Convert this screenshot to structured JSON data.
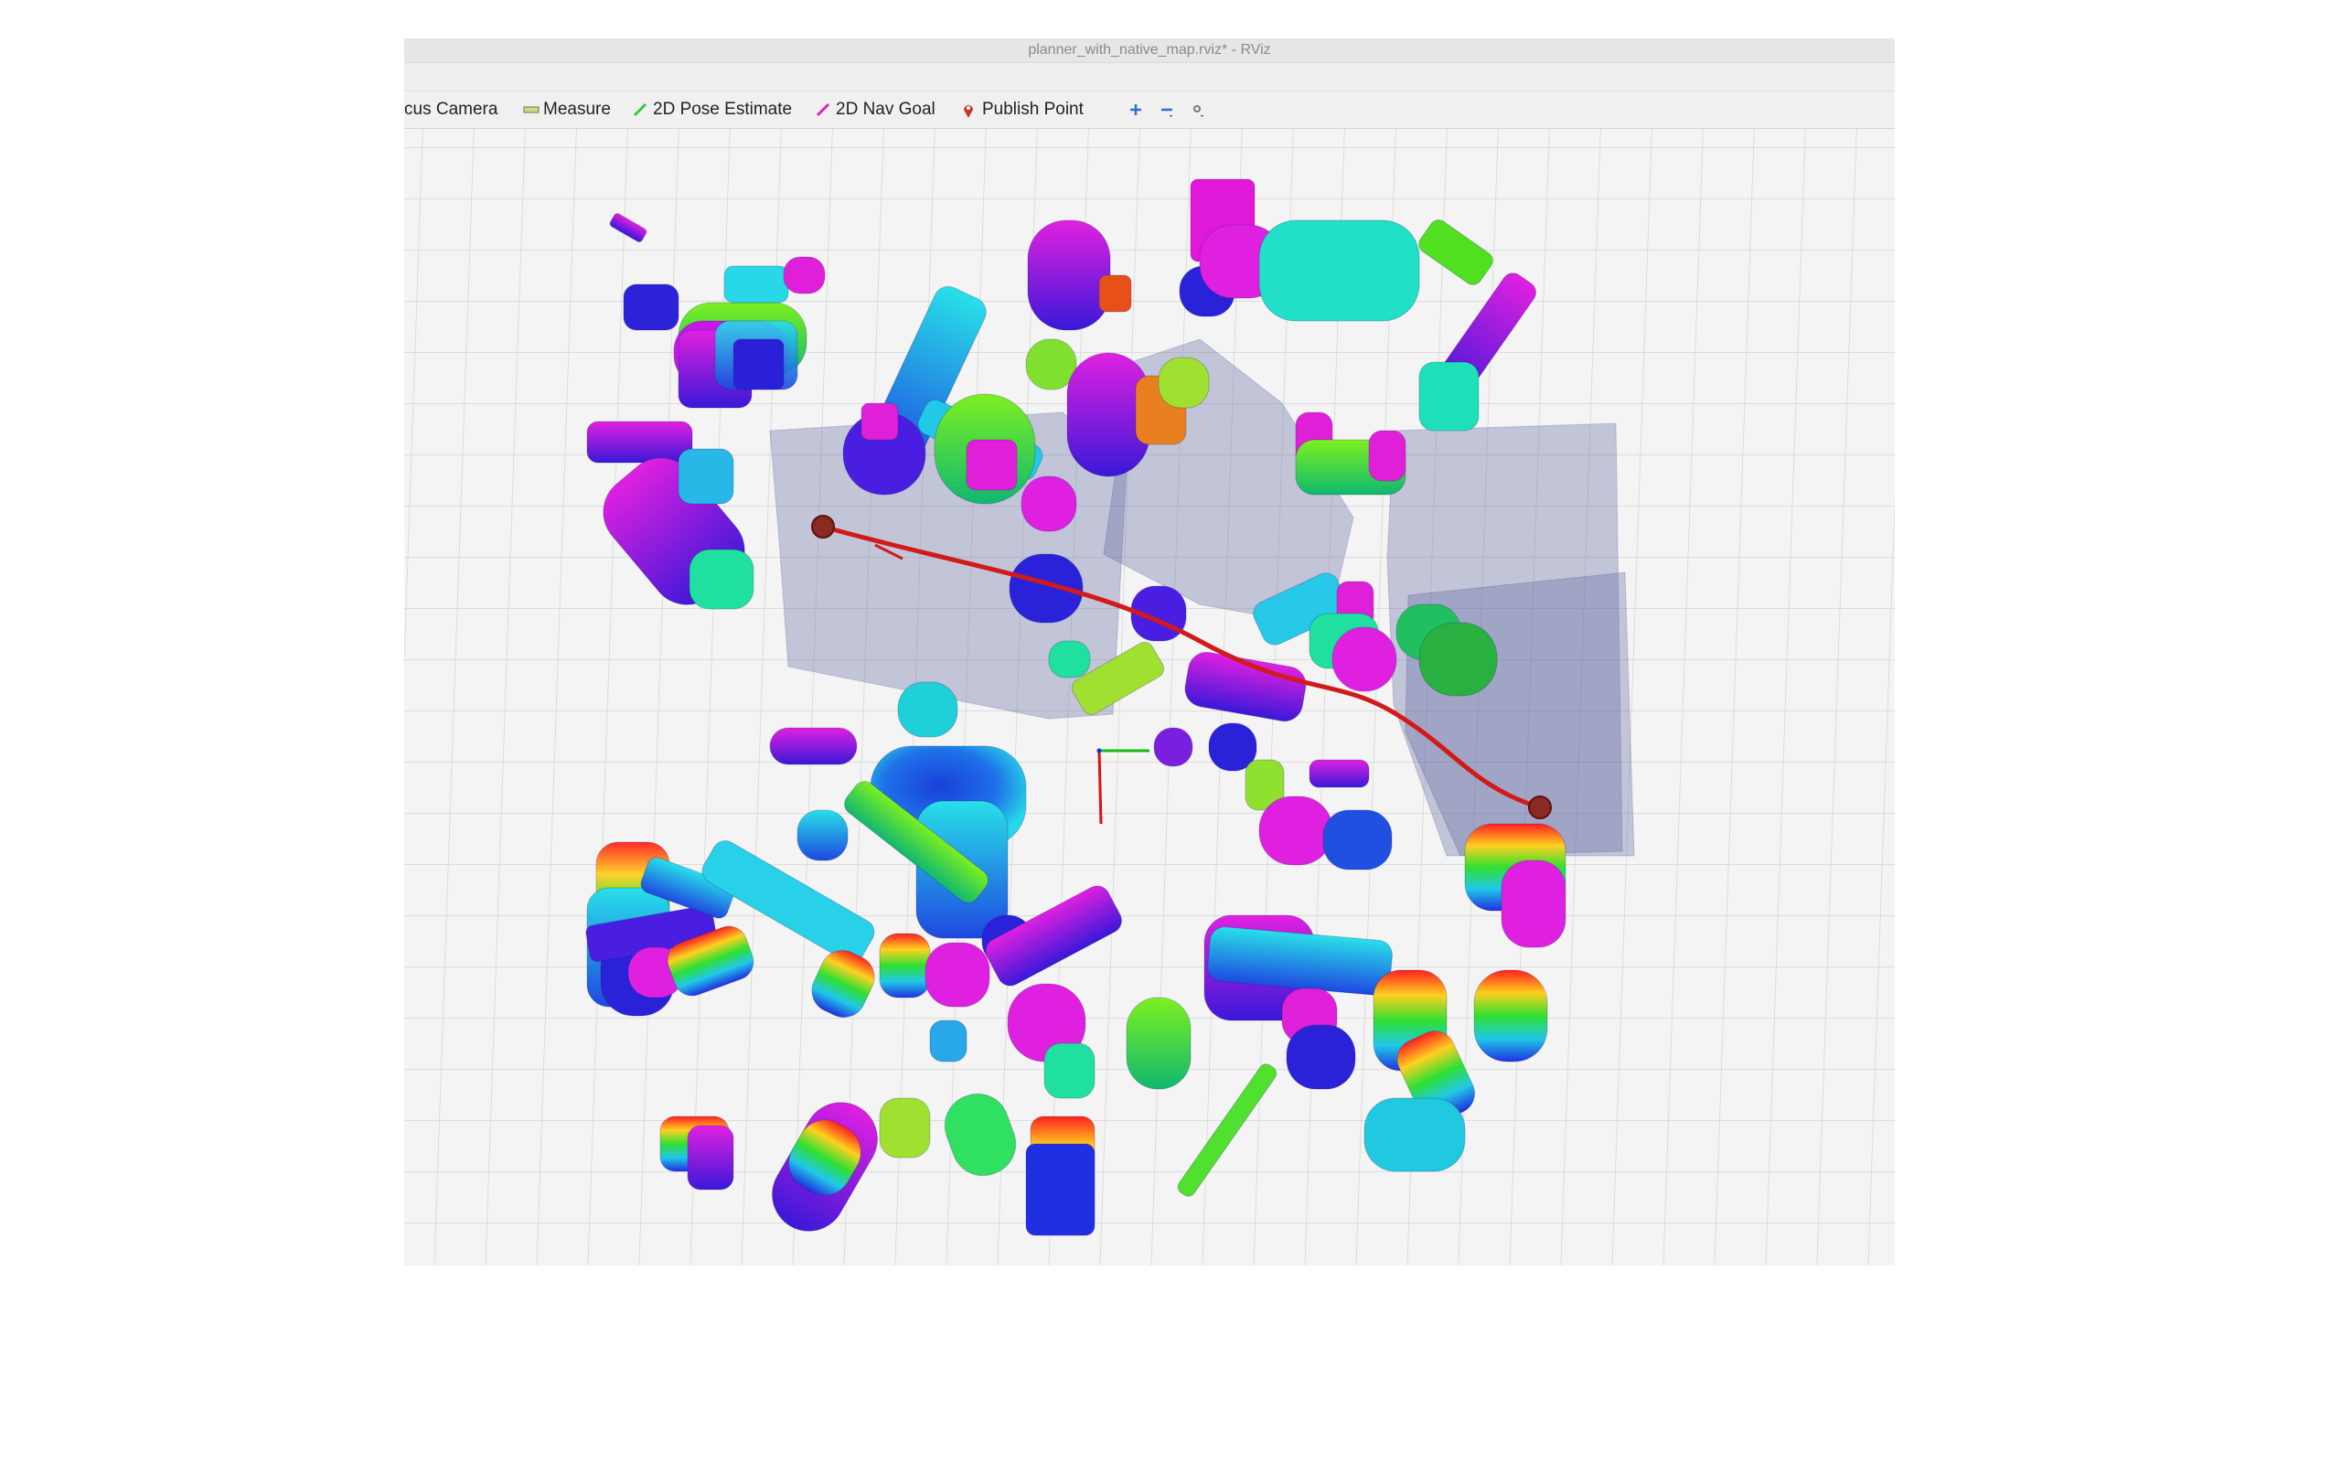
{
  "window": {
    "title": "planner_with_native_map.rviz* - RViz"
  },
  "toolbar": {
    "items": [
      {
        "label": "cus Camera",
        "icon": "focus-camera-icon"
      },
      {
        "label": "Measure",
        "icon": "measure-icon"
      },
      {
        "label": "2D Pose Estimate",
        "icon": "pose-estimate-arrow-icon"
      },
      {
        "label": "2D Nav Goal",
        "icon": "nav-goal-arrow-icon"
      },
      {
        "label": "Publish Point",
        "icon": "publish-point-pin-icon"
      }
    ],
    "extra_icons": [
      "add-tool-icon",
      "remove-tool-icon",
      "camera-type-icon"
    ]
  },
  "colors": {
    "path": "#d11a1a",
    "waypoint": "#8b2a20",
    "corridor": "#6a6fa8",
    "grid_line": "#d2d2d2",
    "viewport_bg": "#f4f4f4"
  }
}
